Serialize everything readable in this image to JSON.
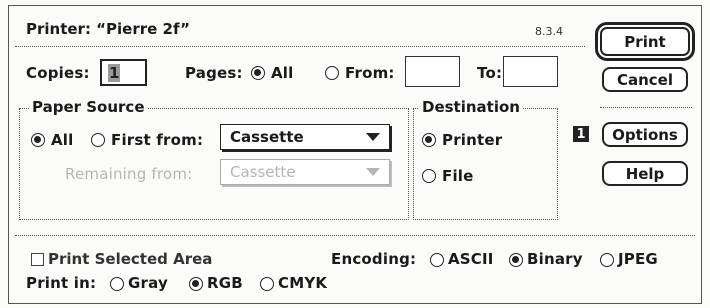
{
  "dialog": {
    "title": "Printer: “Pierre 2f”",
    "version": "8.3.4"
  },
  "copies": {
    "label": "Copies:",
    "value": "1"
  },
  "pages": {
    "label": "Pages:",
    "all_label": "All",
    "from_label": "From:",
    "to_label": "To:",
    "from_value": "",
    "to_value": "",
    "selected": "All"
  },
  "paper_source": {
    "group_label": "Paper Source",
    "all_label": "All",
    "first_from_label": "First from:",
    "first_from_value": "Cassette",
    "remaining_from_label": "Remaining from:",
    "remaining_from_value": "Cassette",
    "selected": "All"
  },
  "destination": {
    "group_label": "Destination",
    "printer_label": "Printer",
    "file_label": "File",
    "selected": "Printer"
  },
  "buttons": {
    "print": "Print",
    "cancel": "Cancel",
    "options": "Options",
    "help": "Help"
  },
  "options_badge": "1",
  "print_selected_area": {
    "label": "Print Selected Area",
    "checked": false
  },
  "encoding": {
    "label": "Encoding:",
    "options": [
      "ASCII",
      "Binary",
      "JPEG"
    ],
    "selected": "Binary"
  },
  "print_in": {
    "label": "Print in:",
    "options": [
      "Gray",
      "RGB",
      "CMYK"
    ],
    "selected": "RGB"
  }
}
